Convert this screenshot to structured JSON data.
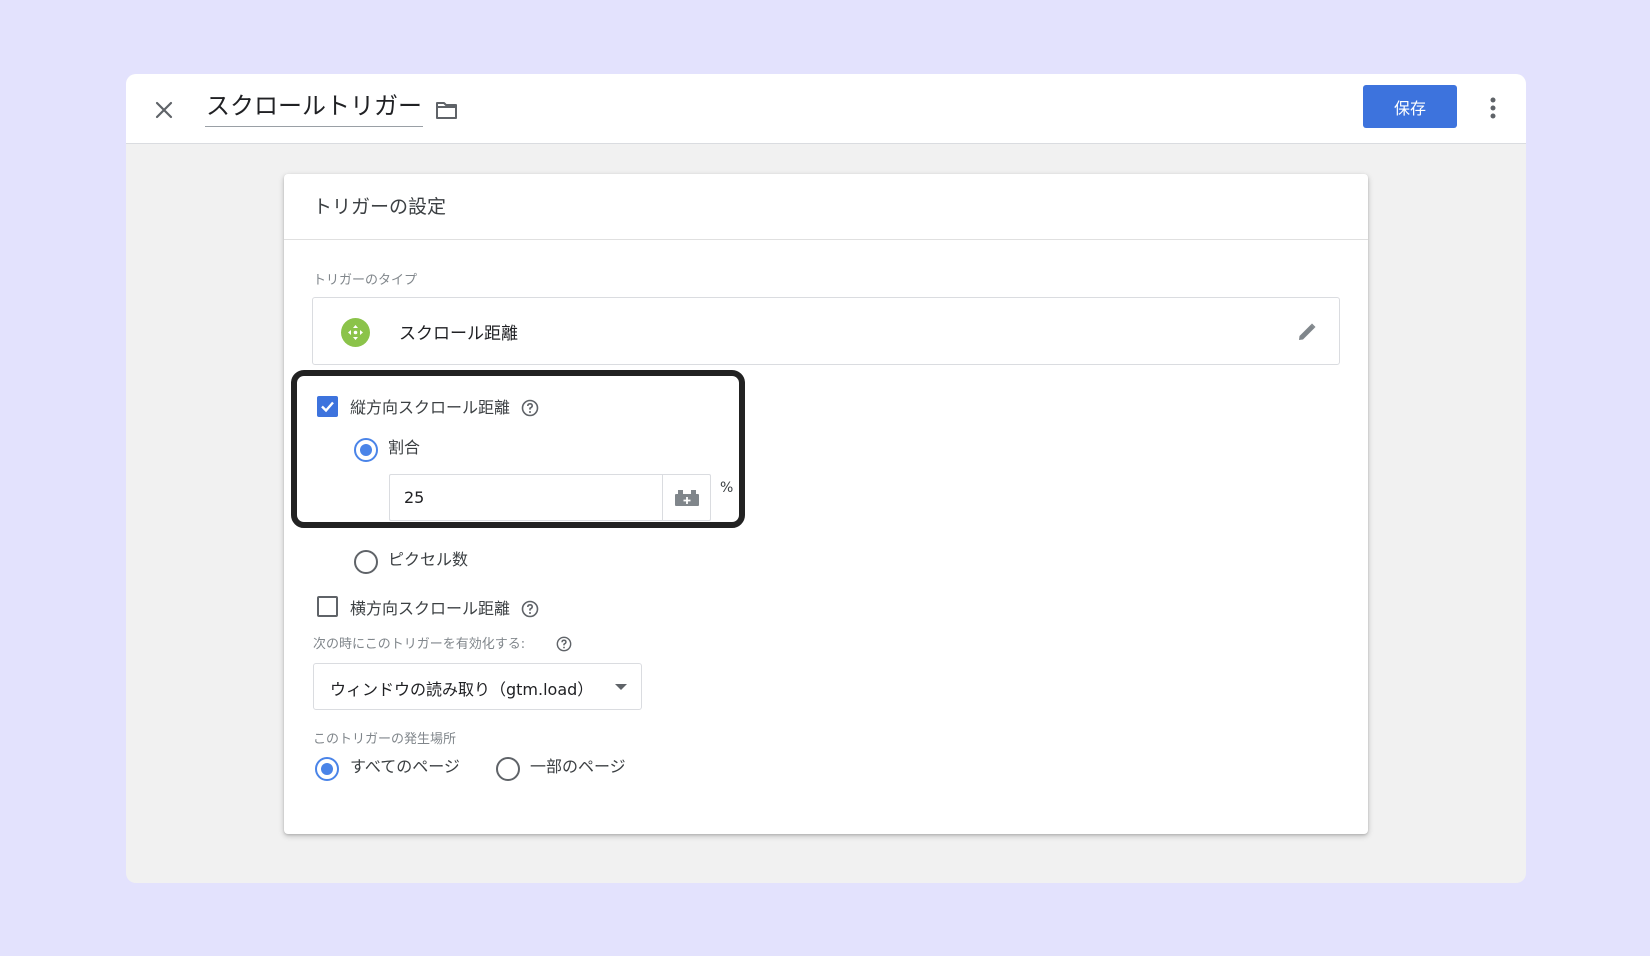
{
  "header": {
    "title": "スクロールトリガー",
    "save_label": "保存"
  },
  "card": {
    "title": "トリガーの設定",
    "trigger_type": {
      "label": "トリガーのタイプ",
      "value": "スクロール距離",
      "icon": "scroll-icon",
      "icon_color": "#8bc34a"
    },
    "vertical": {
      "label": "縦方向スクロール距離",
      "checked": true,
      "mode_percent_label": "割合",
      "percent_value": "25",
      "unit": "%",
      "mode_pixels_label": "ピクセル数"
    },
    "horizontal": {
      "label": "横方向スクロール距離",
      "checked": false
    },
    "enable_when": {
      "label": "次の時にこのトリガーを有効化する:",
      "selected": "ウィンドウの読み取り（gtm.load）"
    },
    "fires_on": {
      "label": "このトリガーの発生場所",
      "all_pages_label": "すべてのページ",
      "some_pages_label": "一部のページ",
      "selected": "all"
    }
  },
  "colors": {
    "background": "#e3e2fd",
    "accent": "#3d73dd",
    "radio": "#4a84e8"
  }
}
